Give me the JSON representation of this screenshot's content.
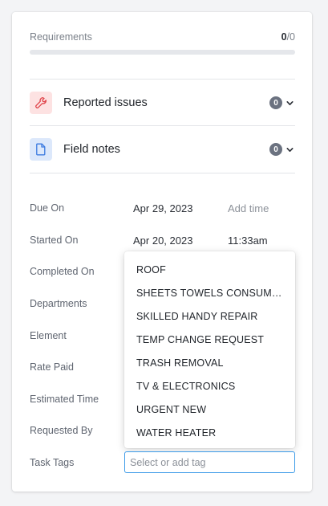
{
  "requirements": {
    "label": "Requirements",
    "done": "0",
    "total": "/0",
    "progress_fraction": 0
  },
  "sections": [
    {
      "title": "Reported issues",
      "count": "0",
      "icon": "wrench-icon",
      "icon_bg": "#fde2e2",
      "icon_color": "#e0454b"
    },
    {
      "title": "Field notes",
      "count": "0",
      "icon": "document-icon",
      "icon_bg": "#dce8fb",
      "icon_color": "#3b7ae0"
    }
  ],
  "fields": {
    "due_on": {
      "label": "Due On",
      "value": "Apr 29, 2023",
      "extra": "Add time"
    },
    "started_on": {
      "label": "Started On",
      "value": "Apr 20, 2023",
      "extra": "11:33am"
    },
    "completed_on": {
      "label": "Completed On"
    },
    "departments": {
      "label": "Departments"
    },
    "element": {
      "label": "Element"
    },
    "rate_paid": {
      "label": "Rate Paid"
    },
    "estimated_time": {
      "label": "Estimated Time"
    },
    "requested_by": {
      "label": "Requested By"
    },
    "task_tags": {
      "label": "Task Tags",
      "placeholder": "Select or add tag"
    }
  },
  "tag_options": [
    "ROOF",
    "SHEETS TOWELS CONSUMABLES",
    "SKILLED HANDY REPAIR",
    "TEMP CHANGE REQUEST",
    "TRASH REMOVAL",
    "TV & ELECTRONICS",
    "URGENT NEW",
    "WATER HEATER"
  ],
  "colors": {
    "accent": "#3b9ae8",
    "badge": "#6b7280"
  }
}
